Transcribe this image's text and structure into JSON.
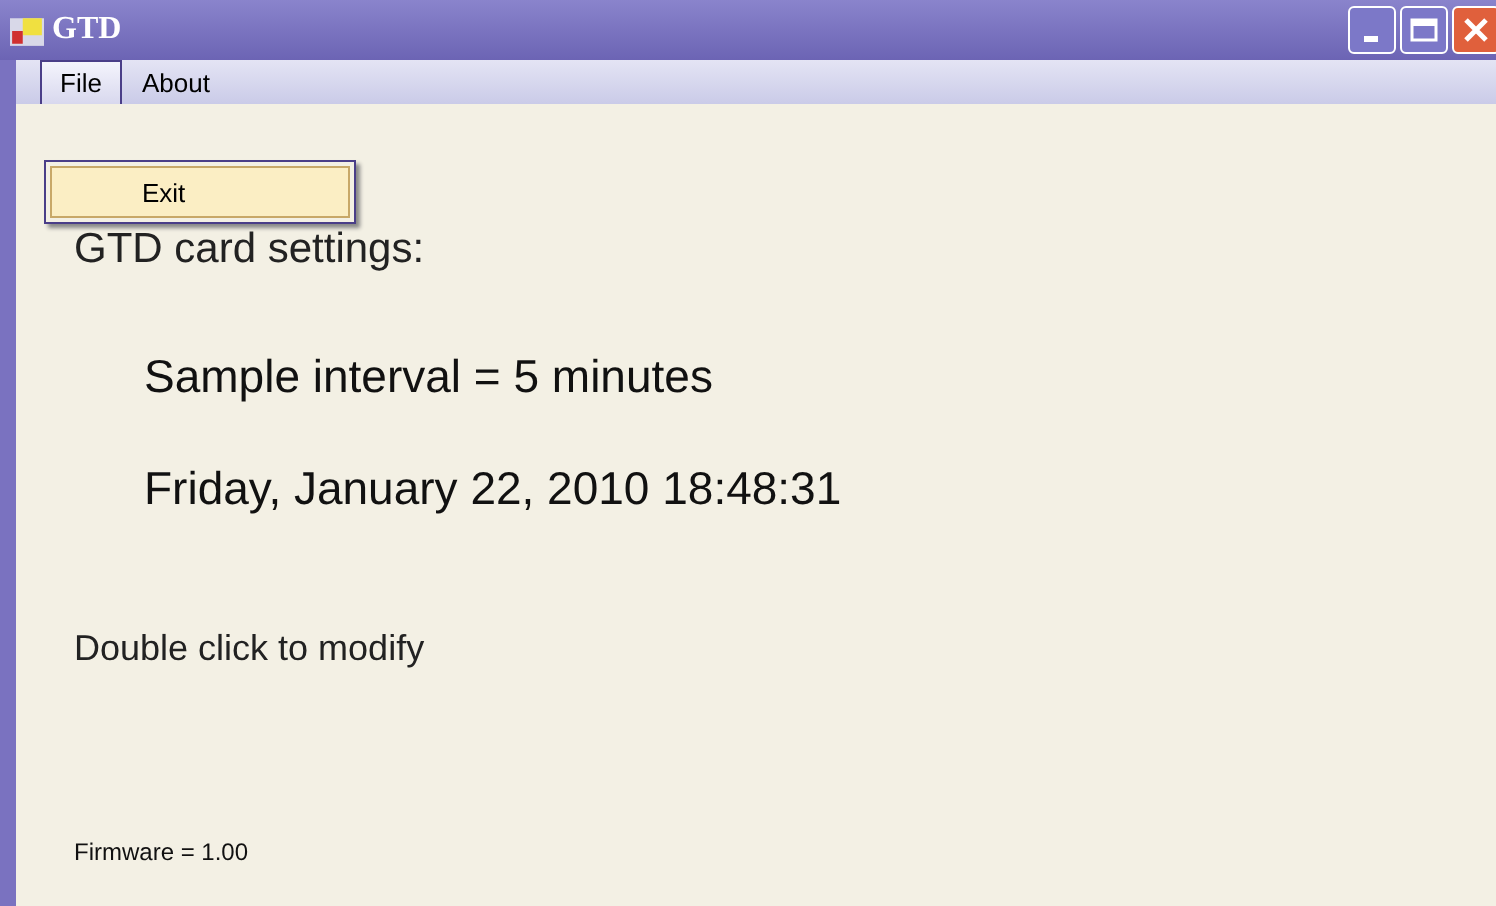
{
  "window": {
    "title": "GTD"
  },
  "menu": [
    {
      "label": "File",
      "selected": true
    },
    {
      "label": "About",
      "selected": false
    }
  ],
  "dropdown": {
    "items": [
      {
        "label": "Exit",
        "selected": true
      }
    ]
  },
  "content": {
    "heading": "GTD card settings:",
    "sample_interval": "Sample interval = 5 minutes",
    "datetime": "Friday, January 22, 2010 18:48:31",
    "hint": "Double click to modify",
    "firmware": "Firmware = 1.00"
  }
}
